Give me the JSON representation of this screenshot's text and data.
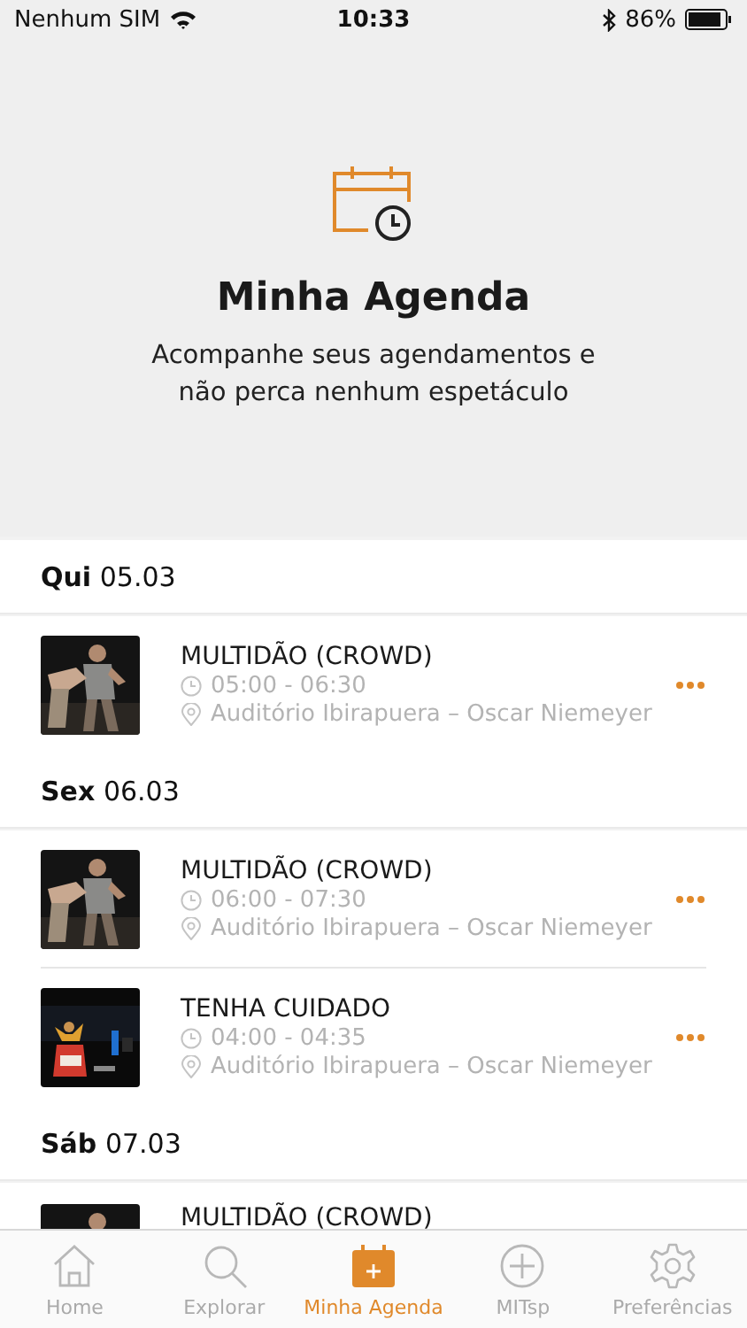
{
  "status_bar": {
    "carrier": "Nenhum SIM",
    "time": "10:33",
    "battery": "86%"
  },
  "header": {
    "title": "Minha Agenda",
    "subtitle": "Acompanhe seus agendamentos e não perca nenhum espetáculo"
  },
  "days": [
    {
      "weekday": "Qui",
      "date": "05.03",
      "events": [
        {
          "title": "MULTIDÃO (CROWD)",
          "time": "05:00 - 06:30",
          "venue": "Auditório Ibirapuera – Oscar Niemeyer"
        }
      ]
    },
    {
      "weekday": "Sex",
      "date": "06.03",
      "events": [
        {
          "title": "MULTIDÃO (CROWD)",
          "time": "06:00 - 07:30",
          "venue": "Auditório Ibirapuera – Oscar Niemeyer"
        },
        {
          "title": "TENHA CUIDADO",
          "time": "04:00 - 04:35",
          "venue": "Auditório Ibirapuera – Oscar Niemeyer"
        }
      ]
    },
    {
      "weekday": "Sáb",
      "date": "07.03",
      "events": [
        {
          "title": "MULTIDÃO (CROWD)"
        }
      ]
    }
  ],
  "tabs": [
    {
      "label": "Home",
      "selected": false
    },
    {
      "label": "Explorar",
      "selected": false
    },
    {
      "label": "Minha Agenda",
      "selected": true
    },
    {
      "label": "MITsp",
      "selected": false
    },
    {
      "label": "Preferências",
      "selected": false
    }
  ]
}
